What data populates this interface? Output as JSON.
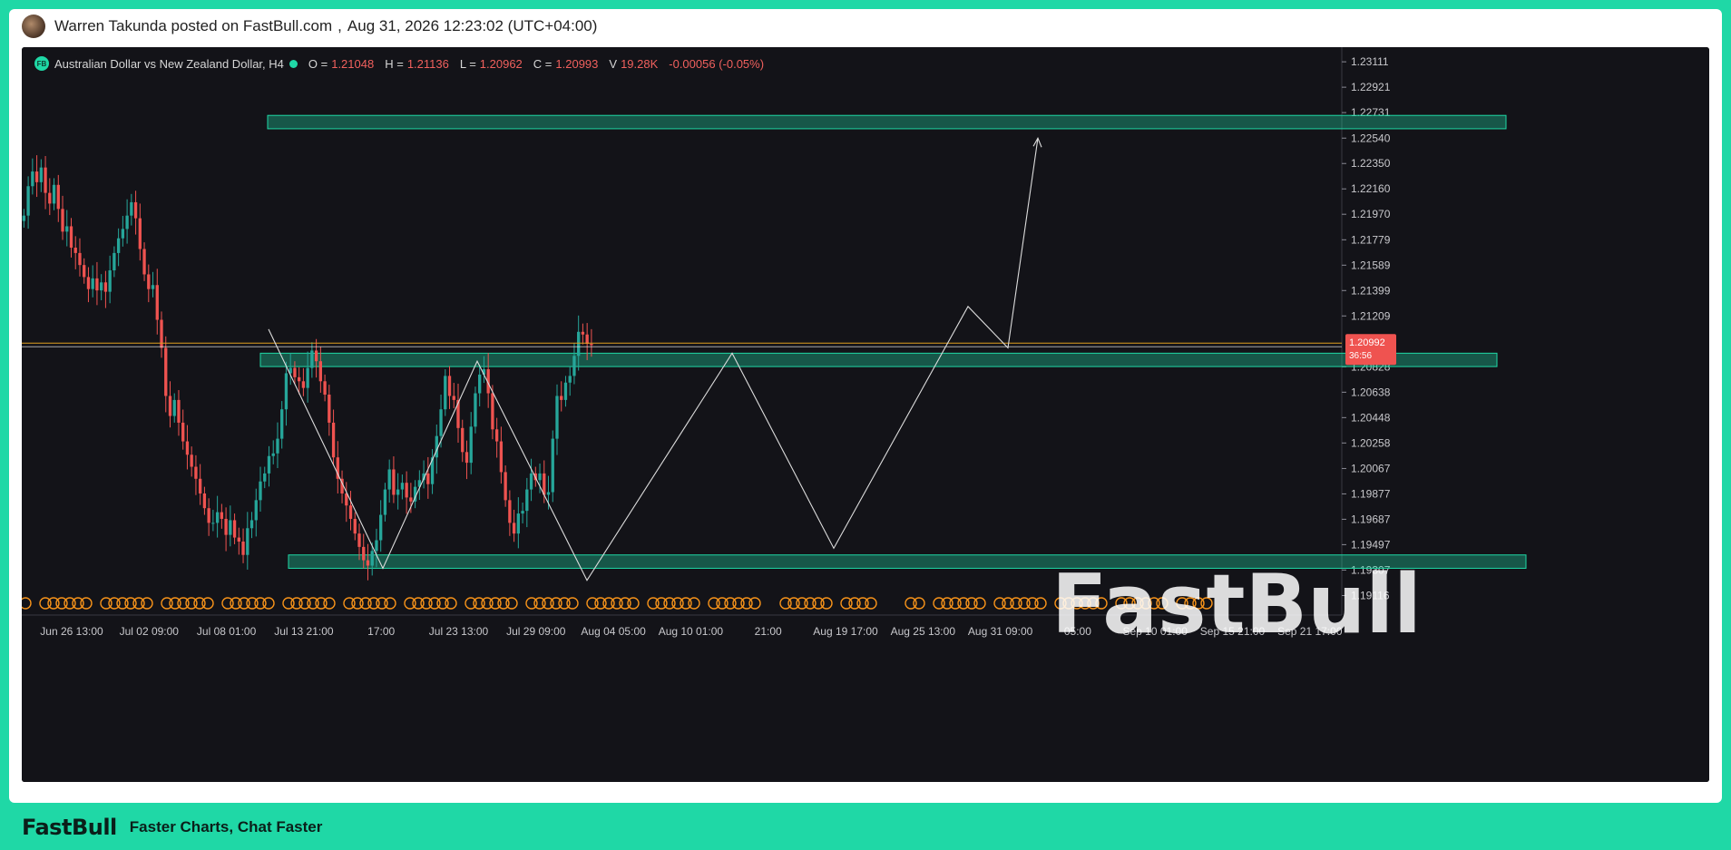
{
  "post": {
    "author_line": "Warren Takunda posted on FastBull.com",
    "separator": ",",
    "datetime": "Aug 31, 2026 12:23:02 (UTC+04:00)"
  },
  "legend": {
    "badge": "FB",
    "symbol_name": "Australian Dollar vs New Zealand Dollar, H4",
    "o_label": "O =",
    "o_value": "1.21048",
    "h_label": "H =",
    "h_value": "1.21136",
    "l_label": "L =",
    "l_value": "1.20962",
    "c_label": "C =",
    "c_value": "1.20993",
    "v_label": "V",
    "v_value": "19.28K",
    "change": "-0.00056 (-0.05%)"
  },
  "watermark": "FastBull",
  "footer": {
    "logo": "FastBull",
    "tagline": "Faster Charts, Chat Faster"
  },
  "colors": {
    "accent": "#1fd8a6",
    "up": "#26a69a",
    "down": "#ef5350",
    "zone": "#1fd8a6",
    "price_tag": "#ef5350",
    "event_marker": "#f7931a"
  },
  "chart_data": {
    "type": "candlestick",
    "instrument": "Australian Dollar vs New Zealand Dollar",
    "timeframe": "H4",
    "y_ticks": [
      "1.23111",
      "1.22921",
      "1.22731",
      "1.22540",
      "1.22350",
      "1.22160",
      "1.21970",
      "1.21779",
      "1.21589",
      "1.21399",
      "1.21209",
      "1.20828",
      "1.20638",
      "1.20448",
      "1.20258",
      "1.20067",
      "1.19877",
      "1.19687",
      "1.19497",
      "1.19307",
      "1.19116"
    ],
    "ylim": [
      1.1897,
      1.2318
    ],
    "x_ticks": [
      "Jun 26 13:00",
      "Jul 02 09:00",
      "Jul 08 01:00",
      "Jul 13 21:00",
      "17:00",
      "Jul 23 13:00",
      "Jul 29 09:00",
      "Aug 04 05:00",
      "Aug 10 01:00",
      "21:00",
      "Aug 19 17:00",
      "Aug 25 13:00",
      "Aug 31 09:00",
      "05:00",
      "Sep 10 01:00",
      "Sep 15 21:00",
      "Sep 21 17:00"
    ],
    "current_price": {
      "value": 1.20992,
      "label": "1.20992",
      "countdown": "36:56"
    },
    "price_series": {
      "bars_per_tick": 18,
      "close": [
        1.2196,
        1.2218,
        1.2229,
        1.2221,
        1.2232,
        1.2213,
        1.2205,
        1.2219,
        1.2201,
        1.2184,
        1.2188,
        1.2172,
        1.2168,
        1.2159,
        1.215,
        1.2141,
        1.2149,
        1.214,
        1.2146,
        1.2139,
        1.2155,
        1.2168,
        1.2179,
        1.2186,
        1.2196,
        1.2206,
        1.2194,
        1.2171,
        1.2152,
        1.2141,
        1.2144,
        1.2118,
        1.2097,
        1.2061,
        1.2046,
        1.2058,
        1.2041,
        1.2027,
        1.2017,
        1.2008,
        1.1999,
        1.1988,
        1.1977,
        1.1966,
        1.1966,
        1.1974,
        1.1969,
        1.1957,
        1.1968,
        1.1955,
        1.1952,
        1.1942,
        1.1962,
        1.1968,
        1.1983,
        1.1997,
        1.2003,
        1.2016,
        1.2018,
        1.2029,
        1.2051,
        1.2078,
        1.2082,
        1.2075,
        1.2072,
        1.2067,
        1.2082,
        1.2095,
        1.2087,
        1.2072,
        1.2062,
        1.2041,
        1.2015,
        1.1999,
        1.1988,
        1.1979,
        1.1969,
        1.1958,
        1.1948,
        1.1938,
        1.1934,
        1.1945,
        1.1953,
        1.1972,
        1.1991,
        1.2006,
        1.1987,
        1.1991,
        1.1996,
        1.1985,
        1.1982,
        1.1993,
        1.1998,
        1.2003,
        1.1995,
        1.2015,
        1.2031,
        1.2051,
        1.2076,
        1.2061,
        1.2058,
        1.2037,
        1.2019,
        1.2011,
        1.2038,
        1.2063,
        1.2077,
        1.2081,
        1.2063,
        1.2036,
        1.2027,
        1.2004,
        1.1983,
        1.1966,
        1.1958,
        1.1973,
        1.1975,
        1.1991,
        1.2003,
        1.1998,
        1.2003,
        1.1987,
        1.1989,
        1.2029,
        1.2061,
        1.2058,
        1.2071,
        1.2076,
        1.2091,
        1.2109,
        1.2107,
        1.21,
        1.2099
      ]
    },
    "zones": [
      {
        "from": 1.2261,
        "to": 1.2271
      },
      {
        "from": 1.2083,
        "to": 1.2093
      },
      {
        "from": 1.1932,
        "to": 1.1942
      }
    ],
    "pattern_path": [
      [
        1.2111,
        1.1932
      ],
      [
        1.1932,
        1.2087
      ],
      [
        1.2087,
        1.1923
      ],
      [
        1.1923,
        1.2093
      ],
      [
        1.2093,
        1.1947
      ],
      [
        1.1947,
        1.2128
      ],
      [
        1.2128,
        1.2097
      ],
      [
        1.2097,
        1.2254
      ]
    ]
  }
}
